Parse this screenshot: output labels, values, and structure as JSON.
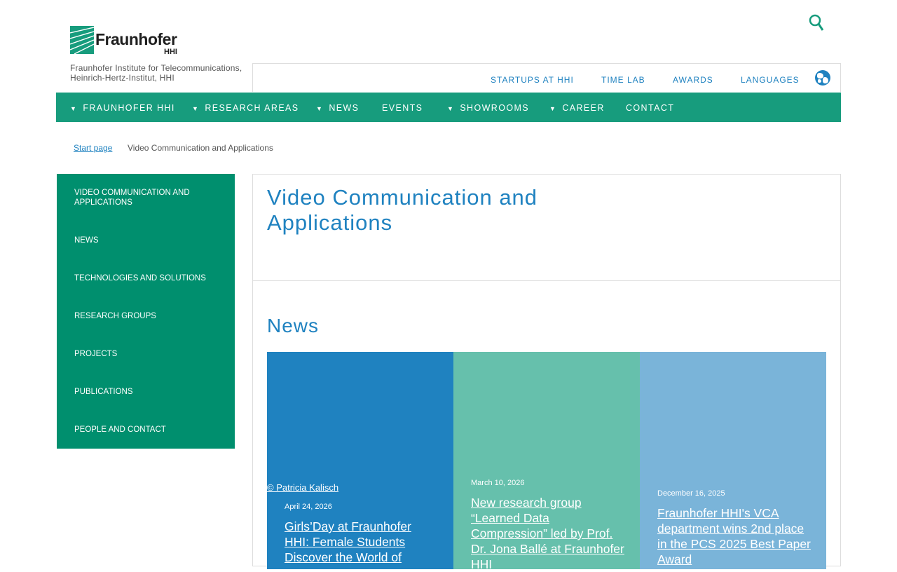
{
  "header": {
    "logo_text": "Fraunhofer",
    "logo_sub": "HHI",
    "institute_line1": "Fraunhofer Institute for Telecommunications,",
    "institute_line2": "Heinrich-Hertz-Institut, HHI",
    "top_links": [
      "STARTUPS AT HHI",
      "TIME LAB",
      "AWARDS",
      "LANGUAGES"
    ]
  },
  "nav": {
    "items": [
      {
        "label": "FRAUNHOFER HHI",
        "has_chevron": true
      },
      {
        "label": "RESEARCH AREAS",
        "has_chevron": true
      },
      {
        "label": "NEWS",
        "has_chevron": true
      },
      {
        "label": "EVENTS",
        "has_chevron": false
      },
      {
        "label": "SHOWROOMS",
        "has_chevron": true
      },
      {
        "label": "CAREER",
        "has_chevron": true
      },
      {
        "label": "CONTACT",
        "has_chevron": false
      }
    ]
  },
  "breadcrumb": {
    "start": "Start page",
    "current": "Video Communication and Applications"
  },
  "sidebar": {
    "items": [
      "VIDEO COMMUNICATION AND APPLICATIONS",
      "NEWS",
      "TECHNOLOGIES AND SOLUTIONS",
      "RESEARCH GROUPS",
      "PROJECTS",
      "PUBLICATIONS",
      "PEOPLE AND CONTACT"
    ]
  },
  "main": {
    "title": "Video Communication and Applications",
    "news_heading": "News",
    "cards": [
      {
        "copyright": "© Patricia Kalisch",
        "date": "April 24, 2026",
        "title": "Girls’Day at Fraunhofer HHI: Female Students Discover the World of",
        "bg": "#1f82c0"
      },
      {
        "copyright": "",
        "date": "March 10, 2026",
        "title": "New research group “Learned Data Compression” led by Prof. Dr. Jona Ballé at Fraunhofer HHI",
        "bg": "#66c0ac"
      },
      {
        "copyright": "",
        "date": "December 16, 2025",
        "title": "Fraunhofer HHI's VCA department wins 2nd place in the PCS 2025 Best Paper Award",
        "bg": "#7ab4d9"
      }
    ]
  },
  "colors": {
    "brand_green": "#179c7d",
    "sidebar_green": "#008f6e",
    "link_blue": "#1f82c0"
  }
}
